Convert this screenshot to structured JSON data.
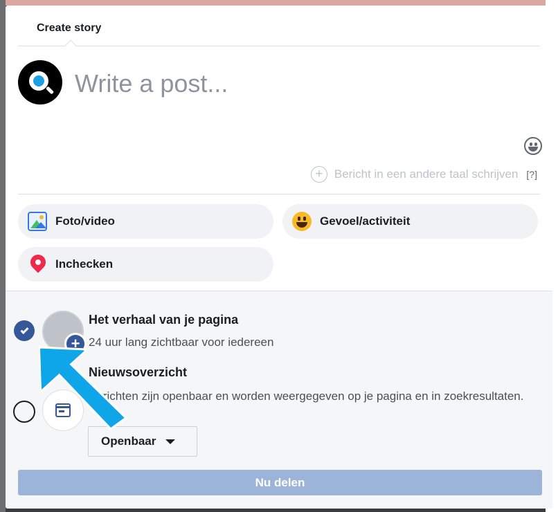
{
  "dialog": {
    "tab_label": "Create story",
    "composer_placeholder": "Write a post...",
    "translate_label": "Bericht in een andere taal schrijven",
    "help_label": "[?]"
  },
  "actions": [
    {
      "label": "Foto/video",
      "icon": "photo-icon"
    },
    {
      "label": "Gevoel/activiteit",
      "icon": "smiley-icon"
    },
    {
      "label": "Inchecken",
      "icon": "location-pin-icon"
    }
  ],
  "destinations": {
    "story": {
      "title": "Het verhaal van je pagina",
      "description": "24 uur lang zichtbaar voor iedereen",
      "selected": true
    },
    "feed": {
      "title": "Nieuwsoverzicht",
      "description": "Berichten zijn openbaar en worden weergegeven op je pagina en in zoekresultaten.",
      "selected": false,
      "audience": "Openbaar"
    }
  },
  "share_button": "Nu delen",
  "colors": {
    "accent": "#365899",
    "share_disabled": "#9cb4d8",
    "annotation_arrow": "#0ea5e9"
  }
}
